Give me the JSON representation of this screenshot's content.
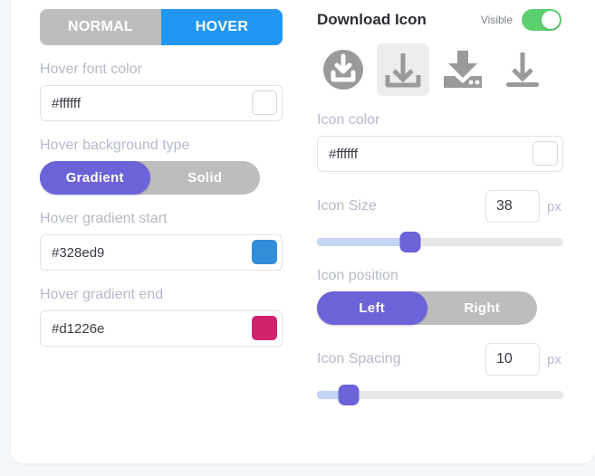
{
  "colors": {
    "accent_blue": "#2196f3",
    "accent_purple": "#6c63d8",
    "toggle_green": "#5cd06f",
    "inactive_gray": "#bdbdbd",
    "label_gray": "#b5b9c9",
    "page_bg": "#f4f7fb"
  },
  "left": {
    "state_tabs": [
      {
        "label": "NORMAL",
        "active": false
      },
      {
        "label": "HOVER",
        "active": true
      }
    ],
    "font_color": {
      "label": "Hover font color",
      "value": "#ffffff",
      "swatch": "#ffffff"
    },
    "background_type": {
      "label": "Hover background type",
      "options": [
        {
          "label": "Gradient",
          "active": true
        },
        {
          "label": "Solid",
          "active": false
        }
      ]
    },
    "gradient_start": {
      "label": "Hover gradient start",
      "value": "#328ed9",
      "swatch": "#328ed9"
    },
    "gradient_end": {
      "label": "Hover gradient end",
      "value": "#d1226e",
      "swatch": "#d1226e"
    }
  },
  "right": {
    "title": "Download Icon",
    "visible": {
      "label": "Visible",
      "on": true
    },
    "icon_choices": [
      {
        "name": "download-circle-tray-icon",
        "selected": false
      },
      {
        "name": "download-arrow-tray-icon",
        "selected": true
      },
      {
        "name": "download-arrow-drive-icon",
        "selected": false
      },
      {
        "name": "download-arrow-bar-icon",
        "selected": false
      }
    ],
    "icon_color": {
      "label": "Icon color",
      "value": "#ffffff",
      "swatch": "#ffffff"
    },
    "icon_size": {
      "label": "Icon Size",
      "value": "38",
      "unit": "px",
      "percent": 38
    },
    "icon_position": {
      "label": "Icon position",
      "options": [
        {
          "label": "Left",
          "active": true
        },
        {
          "label": "Right",
          "active": false
        }
      ]
    },
    "icon_spacing": {
      "label": "Icon Spacing",
      "value": "10",
      "unit": "px",
      "percent": 13
    }
  }
}
